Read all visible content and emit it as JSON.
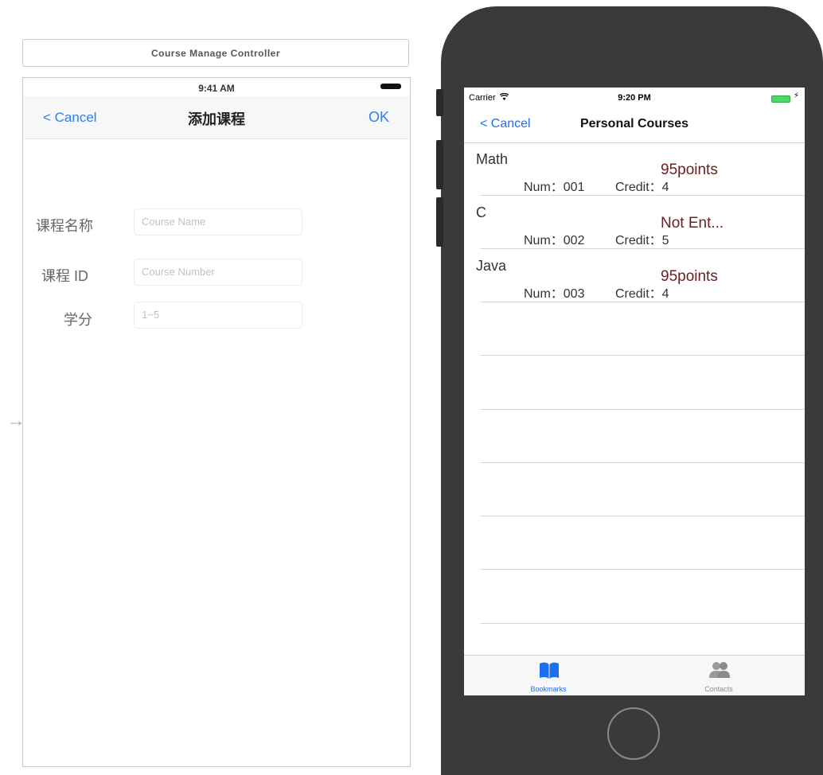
{
  "storyboard": {
    "controller_title": "Course Manage Controller",
    "status_time": "9:41 AM",
    "nav": {
      "cancel": "< Cancel",
      "title": "添加课程",
      "ok": "OK"
    },
    "form": [
      {
        "label": "课程名称",
        "placeholder": "Course Name"
      },
      {
        "label": "课程 ID",
        "placeholder": "Course Number"
      },
      {
        "label": "学分",
        "placeholder": "1~5"
      }
    ],
    "segue_arrow": "→"
  },
  "phone": {
    "status": {
      "carrier": "Carrier",
      "time": "9:20 PM"
    },
    "nav": {
      "cancel": "< Cancel",
      "title": "Personal Courses"
    },
    "courses": [
      {
        "name": "Math",
        "num": "Num：001",
        "credit": "Credit：4",
        "score": "95points"
      },
      {
        "name": "C",
        "num": "Num：002",
        "credit": "Credit：5",
        "score": "Not Ent..."
      },
      {
        "name": "Java",
        "num": "Num：003",
        "credit": "Credit：4",
        "score": "95points"
      }
    ],
    "tabs": [
      {
        "label": "Bookmarks",
        "color": "#1e6ff0"
      },
      {
        "label": "Contacts",
        "color": "#8e8e93"
      }
    ]
  }
}
